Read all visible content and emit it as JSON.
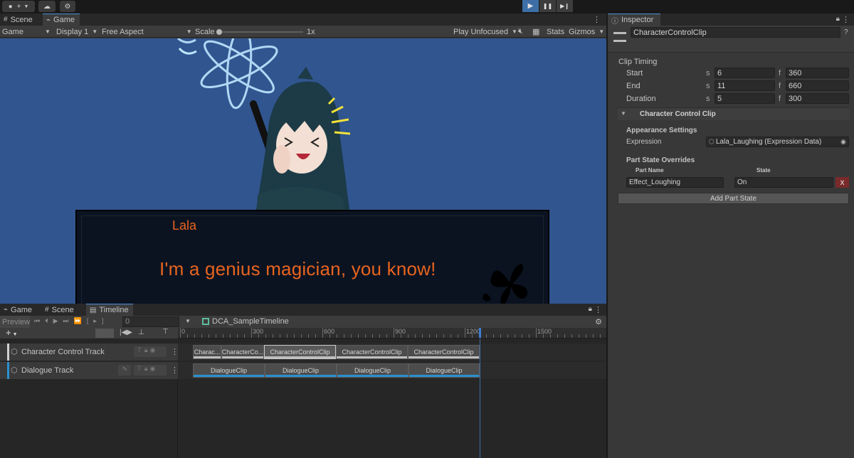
{
  "toolbar": {
    "account_icon": "account-icon",
    "plus_icon": "plus-icon",
    "cloud_icon": "cloud-icon",
    "settings_icon": "settings-icon",
    "play_icon": "▶",
    "pause_icon": "❚❚",
    "step_icon": "▶❙"
  },
  "top_panel": {
    "tabs": [
      "Scene",
      "Game"
    ],
    "game_toolbar": {
      "display_mode": "Game",
      "display": "Display 1",
      "aspect": "Free Aspect",
      "scale_label": "Scale",
      "scale_value": "1x",
      "play_focus": "Play Unfocused",
      "stats": "Stats",
      "gizmos": "Gizmos"
    }
  },
  "game_view": {
    "speaker": "Lala",
    "line": "I'm a genius magician, you know!"
  },
  "bottom_panel": {
    "tabs": [
      "Game",
      "Scene",
      "Timeline"
    ],
    "timeline": {
      "preview_label": "Preview",
      "frame": "0",
      "asset_name": "DCA_SampleTimeline",
      "ruler_ticks": [
        "0",
        "300",
        "600",
        "900",
        "1200",
        "1500"
      ],
      "tracks": [
        {
          "name": "Character Control Track",
          "color": "#d0d0d0",
          "clips": [
            "Charac...",
            "CharacterCo...",
            "CharacterControlClip",
            "CharacterControlClip",
            "CharacterControlClip"
          ]
        },
        {
          "name": "Dialogue Track",
          "color": "#2a8fcf",
          "clips": [
            "DialogueClip",
            "DialogueClip",
            "DialogueClip",
            "DialogueClip"
          ]
        }
      ]
    }
  },
  "inspector": {
    "tab": "Inspector",
    "object_name": "CharacterControlClip",
    "clip_timing": {
      "header": "Clip Timing",
      "rows": [
        {
          "label": "Start",
          "s": "6",
          "f": "360"
        },
        {
          "label": "End",
          "s": "11",
          "f": "660"
        },
        {
          "label": "Duration",
          "s": "5",
          "f": "300"
        }
      ],
      "s_prefix": "s",
      "f_prefix": "f"
    },
    "section": "Character Control Clip",
    "appearance": {
      "header": "Appearance Settings",
      "expression_label": "Expression",
      "expression_value": "Lala_Laughing (Expression Data)"
    },
    "overrides": {
      "header": "Part State Overrides",
      "col_part": "Part Name",
      "col_state": "State",
      "part_name": "Effect_Loughing",
      "state": "On",
      "remove": "X",
      "add_button": "Add Part State"
    }
  }
}
